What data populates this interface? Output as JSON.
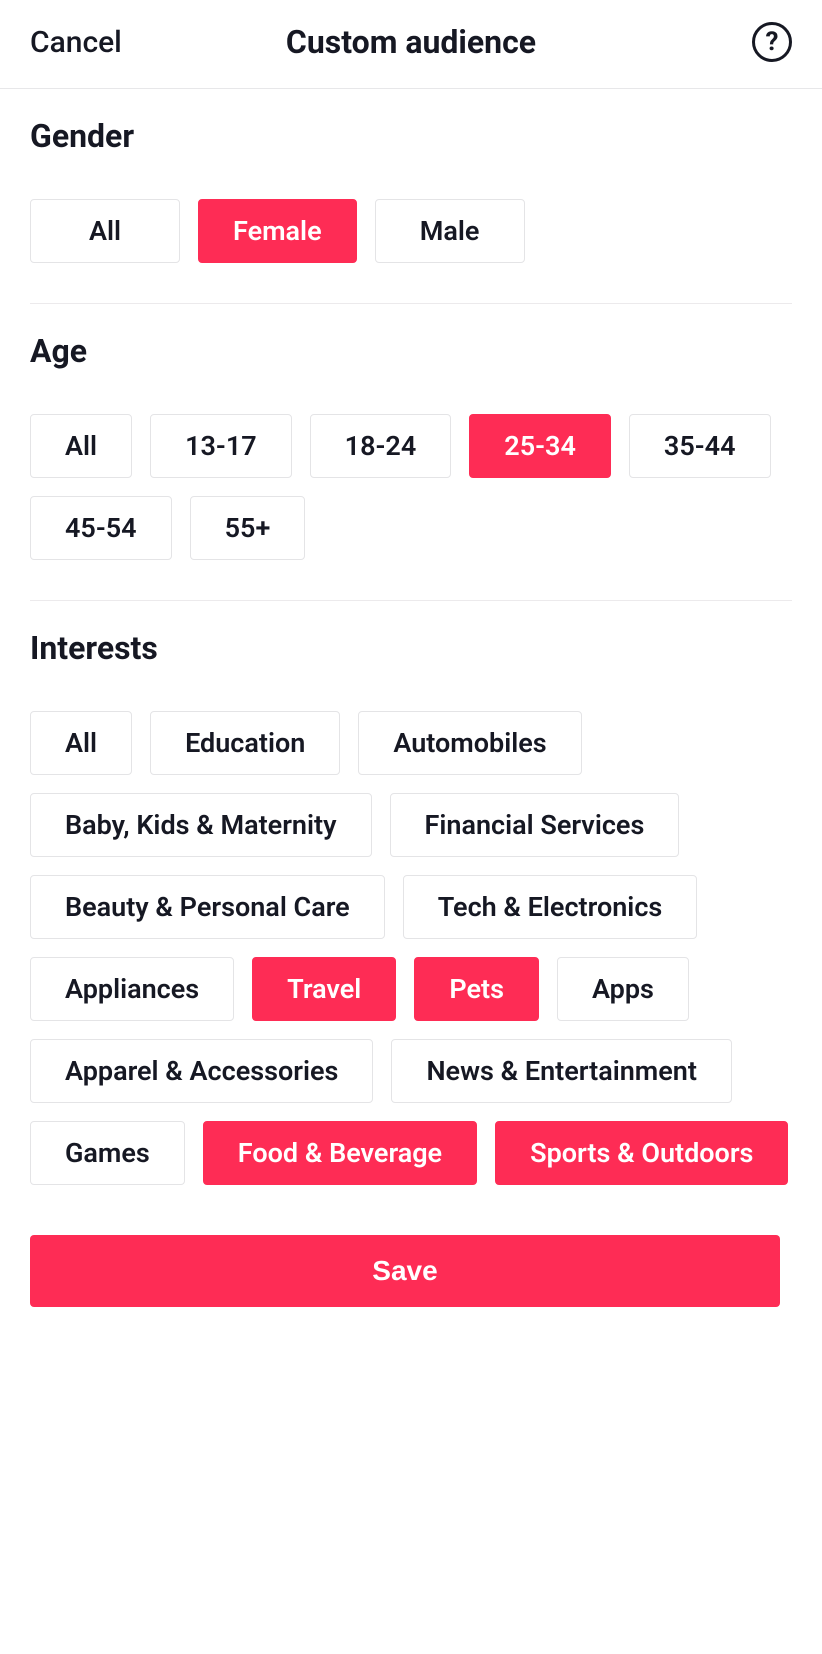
{
  "header": {
    "cancel_label": "Cancel",
    "title": "Custom audience"
  },
  "sections": {
    "gender": {
      "title": "Gender",
      "options": [
        {
          "label": "All",
          "selected": false
        },
        {
          "label": "Female",
          "selected": true
        },
        {
          "label": "Male",
          "selected": false
        }
      ]
    },
    "age": {
      "title": "Age",
      "options": [
        {
          "label": "All",
          "selected": false
        },
        {
          "label": "13-17",
          "selected": false
        },
        {
          "label": "18-24",
          "selected": false
        },
        {
          "label": "25-34",
          "selected": true
        },
        {
          "label": "35-44",
          "selected": false
        },
        {
          "label": "45-54",
          "selected": false
        },
        {
          "label": "55+",
          "selected": false
        }
      ]
    },
    "interests": {
      "title": "Interests",
      "options": [
        {
          "label": "All",
          "selected": false
        },
        {
          "label": "Education",
          "selected": false
        },
        {
          "label": "Automobiles",
          "selected": false
        },
        {
          "label": "Baby, Kids & Maternity",
          "selected": false
        },
        {
          "label": "Financial Services",
          "selected": false
        },
        {
          "label": "Beauty & Personal Care",
          "selected": false
        },
        {
          "label": "Tech & Electronics",
          "selected": false
        },
        {
          "label": "Appliances",
          "selected": false
        },
        {
          "label": "Travel",
          "selected": true
        },
        {
          "label": "Pets",
          "selected": true
        },
        {
          "label": "Apps",
          "selected": false
        },
        {
          "label": "Apparel & Accessories",
          "selected": false
        },
        {
          "label": "News & Entertainment",
          "selected": false
        },
        {
          "label": "Games",
          "selected": false
        },
        {
          "label": "Food & Beverage",
          "selected": true
        },
        {
          "label": "Sports & Outdoors",
          "selected": true
        }
      ]
    }
  },
  "footer": {
    "save_label": "Save"
  },
  "colors": {
    "accent": "#fe2c55"
  }
}
